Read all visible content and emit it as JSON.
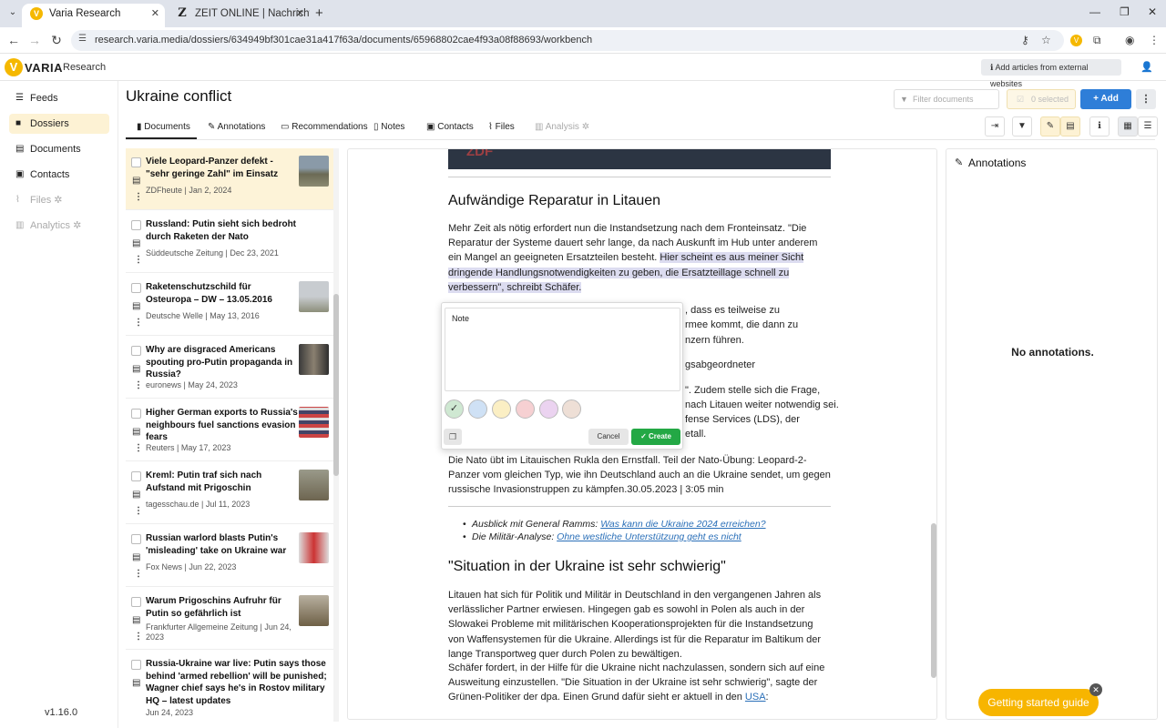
{
  "browser": {
    "tabs": [
      {
        "title": "Varia Research",
        "favicon": "V"
      },
      {
        "title": "ZEIT ONLINE | Nachrichten, Ne",
        "favicon": "Z"
      }
    ],
    "url": "research.varia.media/dossiers/634949bf301cae31a417f63a/documents/65968802cae4f93a08f88693/workbench"
  },
  "app": {
    "logo_letter": "V",
    "logo_name": "VARIA",
    "logo_sub": "Research",
    "external_button": "Add articles from external websites",
    "version": "v1.16.0",
    "accent": "#f5b800"
  },
  "sidebar": {
    "items": [
      {
        "label": "Feeds"
      },
      {
        "label": "Dossiers"
      },
      {
        "label": "Documents"
      },
      {
        "label": "Contacts"
      },
      {
        "label": "Files"
      },
      {
        "label": "Analytics"
      }
    ]
  },
  "main": {
    "title": "Ukraine conflict",
    "filter_placeholder": "Filter documents",
    "selected": "0 selected",
    "add": "Add",
    "tabs": [
      {
        "label": "Documents"
      },
      {
        "label": "Annotations"
      },
      {
        "label": "Recommendations"
      },
      {
        "label": "Notes"
      },
      {
        "label": "Contacts"
      },
      {
        "label": "Files"
      },
      {
        "label": "Analysis"
      }
    ]
  },
  "documents": [
    {
      "title": "Viele Leopard-Panzer defekt - \"sehr geringe Zahl\" im Einsatz",
      "source": "ZDFheute | Jan 2, 2024"
    },
    {
      "title": "Russland: Putin sieht sich bedroht durch Raketen der Nato",
      "source": "Süddeutsche Zeitung | Dec 23, 2021"
    },
    {
      "title": "Raketenschutzschild für Osteuropa – DW – 13.05.2016",
      "source": "Deutsche Welle | May 13, 2016"
    },
    {
      "title": "Why are disgraced Americans spouting pro-Putin propaganda in Russia?",
      "source": "euronews | May 24, 2023"
    },
    {
      "title": "Higher German exports to Russia's neighbours fuel sanctions evasion fears",
      "source": "Reuters | May 17, 2023"
    },
    {
      "title": "Kreml: Putin traf sich nach Aufstand mit Prigoschin",
      "source": "tagesschau.de | Jul 11, 2023"
    },
    {
      "title": "Russian warlord blasts Putin's 'misleading' take on Ukraine war",
      "source": "Fox News | Jun 22, 2023"
    },
    {
      "title": "Warum Prigoschins Aufruhr für Putin so gefährlich ist",
      "source": "Frankfurter Allgemeine Zeitung | Jun 24, 2023"
    },
    {
      "title": "Russia-Ukraine war live: Putin says those behind 'armed rebellion' will be punished; Wagner chief says he's in Rostov military HQ – latest updates",
      "source": "Jun 24, 2023"
    }
  ],
  "article": {
    "h2_1": "Aufwändige Reparatur in Litauen",
    "p1_a": "Mehr Zeit als nötig erfordert nun die Instandsetzung nach dem Fronteinsatz. \"Die Reparatur der Systeme dauert sehr lange, da nach Auskunft im Hub unter anderem ein Mangel an geeigneten Ersatzteilen besteht.",
    "p1_hl": "Hier scheint es aus meiner Sicht dringende Handlungsnotwendigkeiten zu geben, die Ersatzteillage schnell zu verbessern\", schreibt Schäfer.",
    "frag1": ", dass es teilweise zu",
    "frag2": "rmee kommt, die dann zu",
    "frag3": "nzern führen.",
    "frag4": "gsabgeordneter",
    "frag5": "\". Zudem stelle sich die Frage,",
    "frag6": "nach Litauen weiter notwendig sei.",
    "frag7": "fense Services (LDS), der",
    "frag8": "etall.",
    "p_caption": "Die Nato übt im Litauischen Rukla den Ernstfall. Teil der Nato-Übung: Leopard-2-Panzer vom gleichen Typ, wie ihn Deutschland auch an die Ukraine sendet, um gegen russische Invasionstruppen zu kämpfen.30.05.2023 | 3:05 min",
    "li1_label": "Ausblick mit General Ramms: ",
    "li1_link": "Was kann die Ukraine 2024 erreichen?",
    "li2_label": "Die Militär-Analyse: ",
    "li2_link": "Ohne westliche Unterstützung geht es nicht",
    "h2_2": "\"Situation in der Ukraine ist sehr schwierig\"",
    "p2": "Litauen hat sich für Politik und Militär in Deutschland in den vergangenen Jahren als verlässlicher Partner erwiesen. Hingegen gab es sowohl in Polen als auch in der Slowakei Probleme mit militärischen Kooperationsprojekten für die Instandsetzung von Waffensystemen für die Ukraine. Allerdings ist für die Reparatur im Baltikum der lange Transportweg quer durch Polen zu bewältigen.",
    "p3_a": "Schäfer fordert, in der Hilfe für die Ukraine nicht nachzulassen, sondern sich auf eine Ausweitung einzustellen. \"Die Situation in der Ukraine ist sehr schwierig\", sagte der Grünen-Politiker der dpa. Einen Grund dafür sieht er aktuell in den ",
    "p3_link": "USA",
    "p3_b": ":"
  },
  "popup": {
    "note_value": "Note",
    "cancel": "Cancel",
    "create": "Create",
    "colors": [
      "#cfe8d2",
      "#cfe1f5",
      "#fbefc4",
      "#f6d0d2",
      "#ebd3f0",
      "#eedfd6"
    ]
  },
  "annotations": {
    "title": "Annotations",
    "empty": "No annotations."
  },
  "guide": {
    "label": "Getting started guide"
  }
}
